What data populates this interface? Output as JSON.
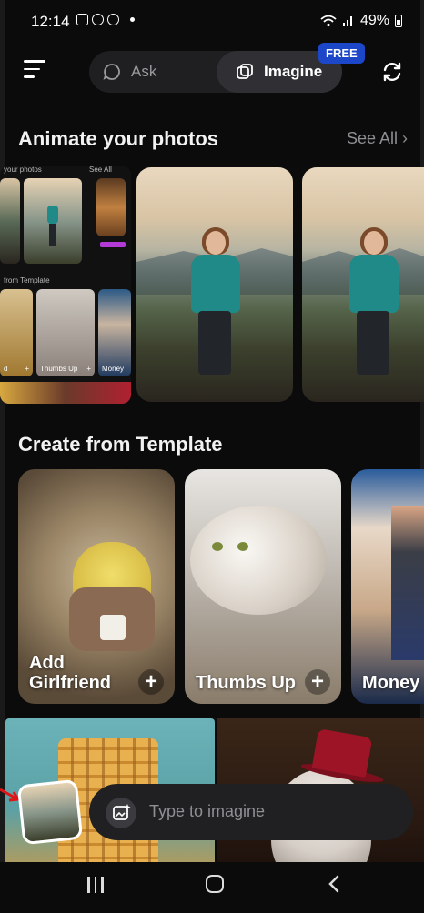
{
  "status_bar": {
    "time": "12:14",
    "battery_percent": "49%"
  },
  "header": {
    "tabs": [
      {
        "label": "Ask",
        "icon": "chat-bubble-icon"
      },
      {
        "label": "Imagine",
        "icon": "layers-icon",
        "selected": true
      }
    ],
    "badge": "FREE"
  },
  "animate": {
    "title": "Animate your photos",
    "see_all": "See All",
    "preview_labels": {
      "top": "your photos",
      "see_all": "See All",
      "template": "from Template"
    },
    "preview_cards": [
      "d",
      "Thumbs Up",
      "Money"
    ]
  },
  "templates": {
    "title": "Create from Template",
    "items": [
      {
        "label": "Add Girlfriend"
      },
      {
        "label": "Thumbs Up"
      },
      {
        "label": "Money"
      }
    ]
  },
  "prompt": {
    "placeholder": "Type to imagine"
  },
  "colors": {
    "accent_blue": "#1d47c9",
    "background": "#0b0b0c",
    "card_bg": "#202022"
  }
}
